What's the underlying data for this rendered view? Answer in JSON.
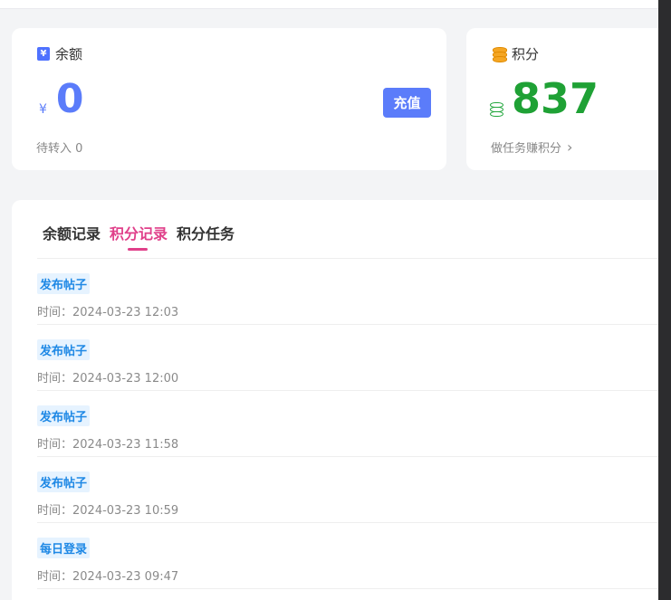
{
  "balance_card": {
    "title": "余额",
    "currency": "¥",
    "value": "0",
    "recharge_label": "充值",
    "pending": "待转入 0"
  },
  "points_card": {
    "title": "积分",
    "value": "837",
    "earn_label": "做任务赚积分",
    "chevron": "›"
  },
  "tabs": [
    "余额记录",
    "积分记录",
    "积分任务"
  ],
  "active_tab": "积分记录",
  "records": [
    {
      "tag": "发布帖子",
      "time": "时间：2024-03-23 12:03"
    },
    {
      "tag": "发布帖子",
      "time": "时间：2024-03-23 12:00"
    },
    {
      "tag": "发布帖子",
      "time": "时间：2024-03-23 11:58"
    },
    {
      "tag": "发布帖子",
      "time": "时间：2024-03-23 10:59"
    },
    {
      "tag": "每日登录",
      "time": "时间：2024-03-23 09:47"
    }
  ],
  "colors": {
    "accent_blue": "#5b7cfa",
    "points_green": "#1fa135",
    "tab_active": "#e0408a",
    "tag_blue": "#1e88e5"
  }
}
